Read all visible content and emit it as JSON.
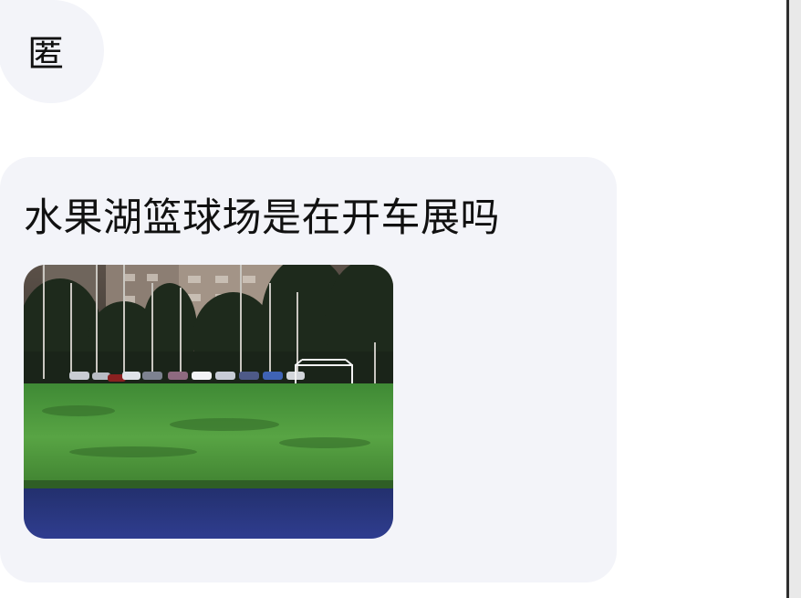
{
  "messages": [
    {
      "text": "匿",
      "kind": "text"
    },
    {
      "text": "水果湖篮球场是在开车展吗",
      "kind": "text-with-image",
      "image_description_icon": "photo"
    }
  ],
  "colors": {
    "bubble": "#f3f4f9",
    "background": "#ffffff",
    "grass": "#4f9a3e",
    "track": "#2d3a8a"
  }
}
